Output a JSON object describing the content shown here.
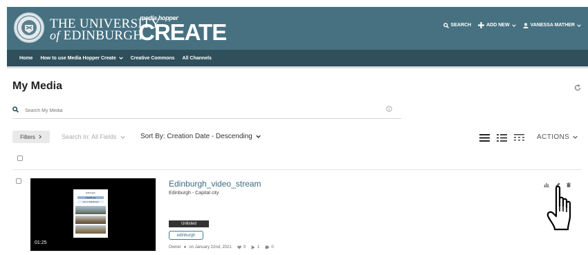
{
  "header": {
    "university_line1": "THE UNIVERSITY",
    "university_line2_prefix": "of",
    "university_line2": "EDINBURGH",
    "logo_small": "media hopper",
    "logo_big": "CREATE",
    "search_label": "SEARCH",
    "add_new_label": "ADD NEW",
    "user_label": "VANESSA MATHER",
    "colors": {
      "topbar": "#477181",
      "navbar": "#2e4f5b"
    }
  },
  "nav": {
    "items": [
      {
        "label": "Home"
      },
      {
        "label": "How to use Media Hopper Create"
      },
      {
        "label": "Creative Commons"
      },
      {
        "label": "All Channels"
      }
    ]
  },
  "page": {
    "title": "My Media",
    "search_placeholder": "Search My Media",
    "filters_label": "Filters",
    "search_in_label": "Search In: All Fields",
    "sort_by_label": "Sort By: Creation Date - Descending",
    "actions_label": "ACTIONS"
  },
  "entries": [
    {
      "title": "Edinburgh_video_stream",
      "description": "Edinburgh - Capital city",
      "duration": "01:25",
      "status_badge": "Unlisted",
      "tag": "edinburgh",
      "owner_label": "Owner",
      "date_label": "on January 22nd, 2021",
      "likes": "0",
      "plays": "1",
      "comments": "0",
      "thumbnail_title": "Edinburgh",
      "thumbnail_subtitle": "Capital city",
      "thumbnail_caption": "City of Edinburgh"
    }
  ]
}
